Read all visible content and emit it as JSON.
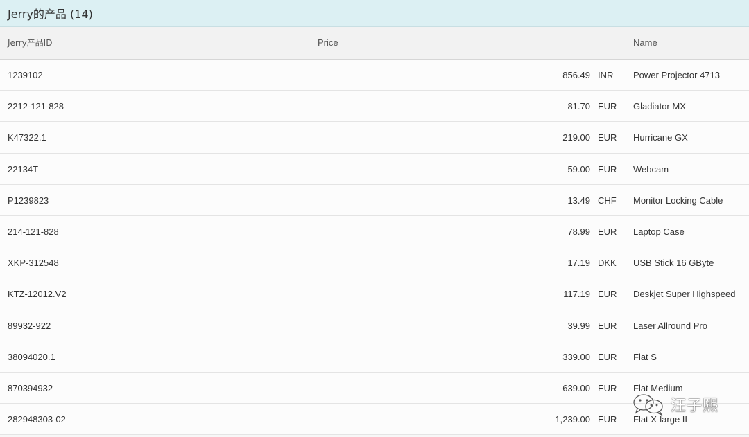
{
  "toolbar": {
    "title": "Jerry的产品 (14)"
  },
  "table": {
    "columns": {
      "id": "Jerry产品ID",
      "price": "Price",
      "name": "Name"
    },
    "rows": [
      {
        "id": "1239102",
        "amount": "856.49",
        "currency": "INR",
        "name": "Power Projector 4713"
      },
      {
        "id": "2212-121-828",
        "amount": "81.70",
        "currency": "EUR",
        "name": "Gladiator MX"
      },
      {
        "id": "K47322.1",
        "amount": "219.00",
        "currency": "EUR",
        "name": "Hurricane GX"
      },
      {
        "id": "22134T",
        "amount": "59.00",
        "currency": "EUR",
        "name": "Webcam"
      },
      {
        "id": "P1239823",
        "amount": "13.49",
        "currency": "CHF",
        "name": "Monitor Locking Cable"
      },
      {
        "id": "214-121-828",
        "amount": "78.99",
        "currency": "EUR",
        "name": "Laptop Case"
      },
      {
        "id": "XKP-312548",
        "amount": "17.19",
        "currency": "DKK",
        "name": "USB Stick 16 GByte"
      },
      {
        "id": "KTZ-12012.V2",
        "amount": "117.19",
        "currency": "EUR",
        "name": "Deskjet Super Highspeed"
      },
      {
        "id": "89932-922",
        "amount": "39.99",
        "currency": "EUR",
        "name": "Laser Allround Pro"
      },
      {
        "id": "38094020.1",
        "amount": "339.00",
        "currency": "EUR",
        "name": "Flat S"
      },
      {
        "id": "870394932",
        "amount": "639.00",
        "currency": "EUR",
        "name": "Flat Medium"
      },
      {
        "id": "282948303-02",
        "amount": "1,239.00",
        "currency": "EUR",
        "name": "Flat X-large II"
      }
    ]
  },
  "watermark": {
    "icon": "wechat-icon",
    "text": "汪子熙"
  },
  "colors": {
    "toolbar_bg": "#dcf0f3",
    "header_bg": "#f2f2f2",
    "row_bg": "#fcfcfc",
    "border": "#e4e4e4"
  }
}
